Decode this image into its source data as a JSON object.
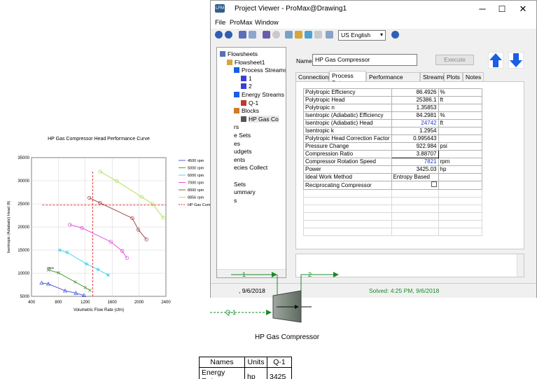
{
  "window": {
    "title": "Project Viewer - ProMax@Drawing1",
    "logo": "LFM",
    "minimize_icon": "─",
    "maximize_icon": "☐",
    "close_icon": "✕"
  },
  "menu": [
    "File",
    "ProMax",
    "Window"
  ],
  "toolbar": {
    "units": "US English"
  },
  "tree": [
    {
      "label": "Flowsheets",
      "icon": "flowsheets-icon",
      "indent": 0
    },
    {
      "label": "Flowsheet1",
      "icon": "flowsheet-icon",
      "indent": 1
    },
    {
      "label": "Process Streams",
      "icon": "streams-icon",
      "indent": 2
    },
    {
      "label": "1",
      "icon": "stream-arrow-icon",
      "indent": 3
    },
    {
      "label": "2",
      "icon": "stream-arrow-icon",
      "indent": 3
    },
    {
      "label": "Energy Streams",
      "icon": "streams-icon",
      "indent": 2
    },
    {
      "label": "Q-1",
      "icon": "energy-arrow-icon",
      "indent": 3
    },
    {
      "label": "Blocks",
      "icon": "blocks-icon",
      "indent": 2
    },
    {
      "label": "HP Gas Co",
      "icon": "compressor-icon",
      "indent": 3
    },
    {
      "label": "rs",
      "icon": "",
      "indent": 2
    },
    {
      "label": "e Sets",
      "icon": "",
      "indent": 2
    },
    {
      "label": "es",
      "icon": "",
      "indent": 2
    },
    {
      "label": "udgets",
      "icon": "",
      "indent": 2
    },
    {
      "label": "ents",
      "icon": "",
      "indent": 2
    },
    {
      "label": "ecies Collect",
      "icon": "",
      "indent": 2
    },
    {
      "label": "",
      "icon": "",
      "indent": 2
    },
    {
      "label": "Sets",
      "icon": "",
      "indent": 2
    },
    {
      "label": "ummary",
      "icon": "",
      "indent": 2
    },
    {
      "label": "s",
      "icon": "",
      "indent": 2
    }
  ],
  "details": {
    "name_label": "Name",
    "name_value": "HP Gas Compressor",
    "execute_label": "Execute",
    "tabs": [
      "Connections",
      "Process Data",
      "Performance Curves",
      "Streams",
      "Plots",
      "Notes"
    ],
    "active_tab": "Process Data",
    "rows": [
      {
        "name": "Polytropic Efficiency",
        "value": "86.4926",
        "unit": "%",
        "blue": false
      },
      {
        "name": "Polytropic Head",
        "value": "25386.1",
        "unit": "ft",
        "blue": false
      },
      {
        "name": "Polytropic n",
        "value": "1.35853",
        "unit": "",
        "blue": false
      },
      {
        "name": "Isentropic (Adiabatic) Efficiency",
        "value": "84.2981",
        "unit": "%",
        "blue": false
      },
      {
        "name": "Isentropic (Adiabatic) Head",
        "value": "24742",
        "unit": "ft",
        "blue": true
      },
      {
        "name": "Isentropic k",
        "value": "1.2954",
        "unit": "",
        "blue": false
      },
      {
        "name": "Polytropic Head Correction Factor",
        "value": "0.995643",
        "unit": "",
        "blue": false
      },
      {
        "name": "Pressure Change",
        "value": "922.984",
        "unit": "psi",
        "blue": false
      },
      {
        "name": "Compression Ratio",
        "value": "3.88707",
        "unit": "",
        "blue": false
      },
      {
        "name": "Compressor Rotation Speed",
        "value": "7821",
        "unit": "rpm",
        "blue": true
      },
      {
        "name": "Power",
        "value": "3425.03",
        "unit": "hp",
        "blue": false
      },
      {
        "name": "Ideal Work Method",
        "value": "Entropy Based",
        "unit": "",
        "blue": false
      },
      {
        "name": "Reciprocating Compressor",
        "value": "",
        "unit": "",
        "blue": false
      }
    ]
  },
  "statusbar": {
    "left": ", 9/6/2018",
    "solved": "Solved:  4:25 PM, 9/6/2018"
  },
  "pfd": {
    "stream_in": "1",
    "stream_out": "2",
    "energy": "Q-1",
    "block_label": "HP Gas Compressor"
  },
  "summary_table": {
    "headers": [
      "Names",
      "Units",
      "Q-1"
    ],
    "row": [
      "Energy Rate",
      "hp",
      "3425"
    ]
  },
  "chart_data": {
    "type": "line",
    "title": "HP Gas Compressor Head Performance Curve",
    "xlabel": "Volumetric Flow Rate (cfm)",
    "ylabel": "Isentropic (Adiabatic) Head (ft)",
    "xlim": [
      400,
      2400
    ],
    "ylim": [
      5000,
      35000
    ],
    "xticks": [
      400,
      800,
      1200,
      1600,
      2000,
      2400
    ],
    "yticks": [
      5000,
      10000,
      15000,
      20000,
      25000,
      30000,
      35000
    ],
    "annotation": "35ps",
    "series": [
      {
        "name": "4500 rpm",
        "color": "#3a4fd8",
        "marker": "triangle",
        "x": [
          550,
          650,
          900,
          1060,
          1180
        ],
        "y": [
          7900,
          7700,
          6200,
          5700,
          5200
        ]
      },
      {
        "name": "5000 rpm",
        "color": "#3f8f2c",
        "marker": "x",
        "x": [
          650,
          800,
          1050,
          1200,
          1270
        ],
        "y": [
          10700,
          10100,
          8100,
          6900,
          6300
        ]
      },
      {
        "name": "6000 rpm",
        "color": "#39d0e8",
        "marker": "star",
        "x": [
          820,
          930,
          1220,
          1390,
          1540
        ],
        "y": [
          15000,
          14500,
          12000,
          10800,
          9600
        ]
      },
      {
        "name": "7000 rpm",
        "color": "#e33fe0",
        "marker": "circle",
        "x": [
          970,
          1150,
          1580,
          1750,
          1820
        ],
        "y": [
          20500,
          19800,
          16800,
          14800,
          13300
        ]
      },
      {
        "name": "8000 rpm",
        "color": "#a13a3a",
        "marker": "circle",
        "x": [
          1260,
          1420,
          1900,
          1990,
          2110
        ],
        "y": [
          26300,
          25200,
          21900,
          19400,
          17300
        ]
      },
      {
        "name": "8856 rpm",
        "color": "#a8e04a",
        "marker": "circle",
        "x": [
          1420,
          1670,
          2040,
          2200,
          2360
        ],
        "y": [
          32000,
          29900,
          26500,
          25000,
          22000
        ]
      }
    ],
    "operating_point": {
      "name": "HP Gas Compressor Specifications",
      "color": "#e02020",
      "x": 1310,
      "y": 24742
    }
  }
}
